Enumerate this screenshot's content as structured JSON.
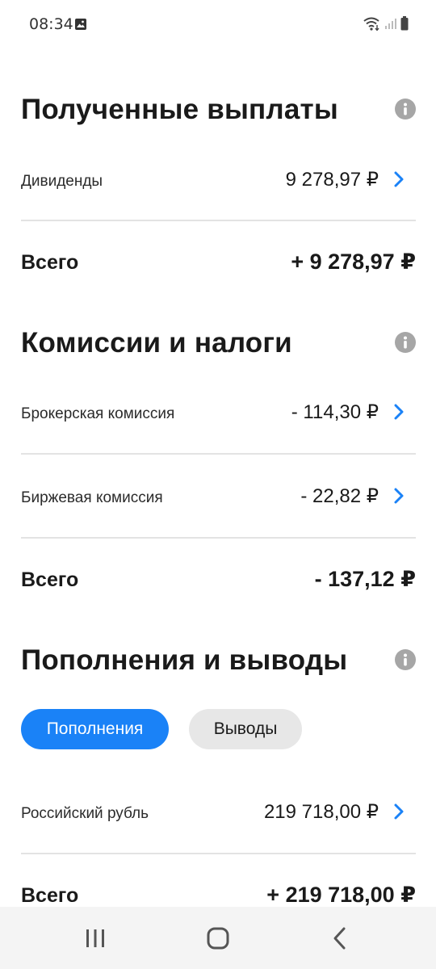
{
  "status_bar": {
    "time": "08:34",
    "icons": [
      "gallery-icon",
      "wifi-icon",
      "signal-icon",
      "battery-icon"
    ]
  },
  "received": {
    "title": "Полученные выплаты",
    "rows": [
      {
        "label": "Дивиденды",
        "value": "9 278,97 ₽"
      }
    ],
    "total_label": "Всего",
    "total_value": "+ 9 278,97 ₽"
  },
  "fees": {
    "title": "Комиссии и налоги",
    "rows": [
      {
        "label": "Брокерская комиссия",
        "value": "- 114,30 ₽"
      },
      {
        "label": "Биржевая комиссия",
        "value": "- 22,82 ₽"
      }
    ],
    "total_label": "Всего",
    "total_value": "- 137,12 ₽"
  },
  "transfers": {
    "title": "Пополнения и выводы",
    "tabs": [
      {
        "label": "Пополнения",
        "active": true
      },
      {
        "label": "Выводы",
        "active": false
      }
    ],
    "rows": [
      {
        "label": "Российский рубль",
        "value": "219 718,00 ₽"
      }
    ],
    "total_label": "Всего",
    "total_value": "+ 219 718,00 ₽"
  },
  "colors": {
    "accent": "#1a82f7",
    "info_icon": "#a6a6a6",
    "divider": "#e3e3e3",
    "nav_bar": "#f4f4f4"
  },
  "nav_bar": {
    "buttons": [
      "recents-icon",
      "home-icon",
      "back-icon"
    ]
  }
}
